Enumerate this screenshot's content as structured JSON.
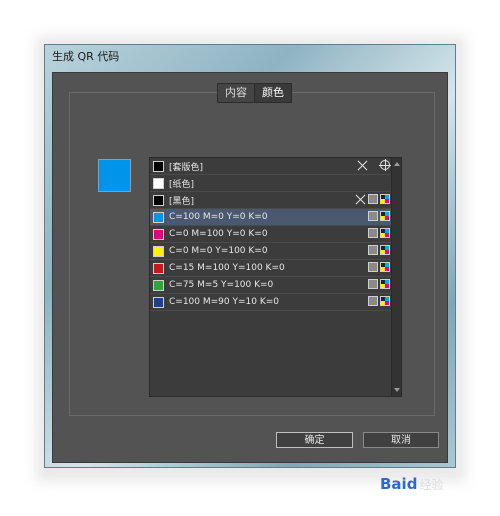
{
  "window": {
    "title": "生成 QR 代码"
  },
  "tabs": [
    {
      "label": "内容"
    },
    {
      "label": "颜色"
    }
  ],
  "preview": {
    "color": "#0095e8"
  },
  "swatches": [
    {
      "label": "[套版色]",
      "color": "#000000"
    },
    {
      "label": "[纸色]",
      "color": "#ffffff"
    },
    {
      "label": "[黑色]",
      "color": "#000000"
    },
    {
      "label": "C=100 M=0 Y=0 K=0",
      "color": "#0095e8"
    },
    {
      "label": "C=0 M=100 Y=0 K=0",
      "color": "#e6007e"
    },
    {
      "label": "C=0 M=0 Y=100 K=0",
      "color": "#fff100"
    },
    {
      "label": "C=15 M=100 Y=100 K=0",
      "color": "#c8161d"
    },
    {
      "label": "C=75 M=5 Y=100 K=0",
      "color": "#2ea43a"
    },
    {
      "label": "C=100 M=90 Y=10 K=0",
      "color": "#1e3f91"
    }
  ],
  "buttons": {
    "ok": "确定",
    "cancel": "取消"
  },
  "watermark": {
    "brand": "Baid",
    "suffix": "经验"
  }
}
